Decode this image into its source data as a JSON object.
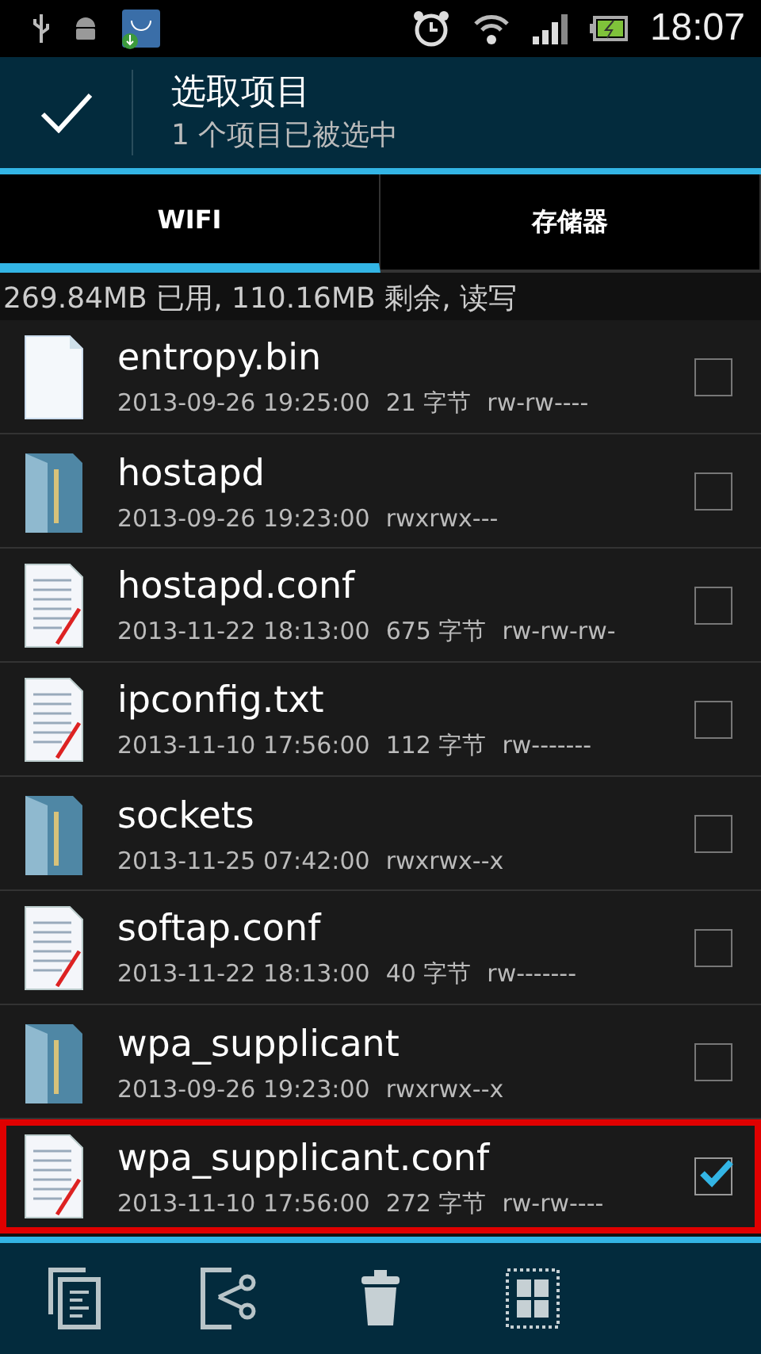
{
  "status_bar": {
    "time": "18:07"
  },
  "action_bar": {
    "title": "选取项目",
    "subtitle": "1 个项目已被选中"
  },
  "tabs": [
    {
      "label": "WIFI",
      "selected": true
    },
    {
      "label": "存储器",
      "selected": false
    }
  ],
  "storage_info": "269.84MB 已用, 110.16MB 剩余, 读写",
  "files": [
    {
      "kind": "blank",
      "name": "entropy.bin",
      "date": "2013-09-26 19:25:00",
      "size": "21 字节",
      "perms": "rw-rw----",
      "checked": false,
      "highlighted": false
    },
    {
      "kind": "folder",
      "name": "hostapd",
      "date": "2013-09-26 19:23:00",
      "perms": "rwxrwx---",
      "checked": false,
      "highlighted": false
    },
    {
      "kind": "text",
      "name": "hostapd.conf",
      "date": "2013-11-22 18:13:00",
      "size": "675 字节",
      "perms": "rw-rw-rw-",
      "checked": false,
      "highlighted": false
    },
    {
      "kind": "text",
      "name": "ipconfig.txt",
      "date": "2013-11-10 17:56:00",
      "size": "112 字节",
      "perms": "rw-------",
      "checked": false,
      "highlighted": false
    },
    {
      "kind": "folder",
      "name": "sockets",
      "date": "2013-11-25 07:42:00",
      "perms": "rwxrwx--x",
      "checked": false,
      "highlighted": false
    },
    {
      "kind": "text",
      "name": "softap.conf",
      "date": "2013-11-22 18:13:00",
      "size": "40 字节",
      "perms": "rw-------",
      "checked": false,
      "highlighted": false
    },
    {
      "kind": "folder",
      "name": "wpa_supplicant",
      "date": "2013-09-26 19:23:00",
      "perms": "rwxrwx--x",
      "checked": false,
      "highlighted": false
    },
    {
      "kind": "text",
      "name": "wpa_supplicant.conf",
      "date": "2013-11-10 17:56:00",
      "size": "272 字节",
      "perms": "rw-rw----",
      "checked": true,
      "highlighted": true
    }
  ]
}
